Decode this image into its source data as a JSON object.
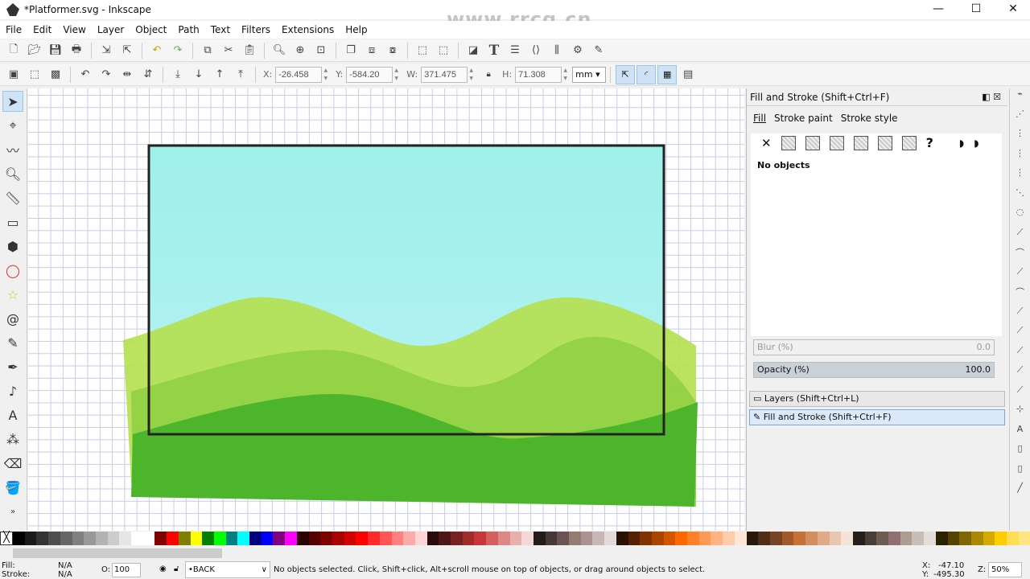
{
  "window": {
    "title": "*Platformer.svg - Inkscape",
    "minimize": "—",
    "maximize": "☐",
    "close": "✕"
  },
  "watermark": "www.rrcg.cn",
  "menu": [
    "File",
    "Edit",
    "View",
    "Layer",
    "Object",
    "Path",
    "Text",
    "Filters",
    "Extensions",
    "Help"
  ],
  "toolbar1_icons": [
    "new-icon",
    "open-icon",
    "save-icon",
    "print-icon",
    "import-icon",
    "export-icon",
    "undo-icon",
    "redo-icon",
    "copy-icon",
    "cut-icon",
    "paste-icon",
    "zoom-selection-icon",
    "zoom-drawing-icon",
    "zoom-page-icon",
    "duplicate-icon",
    "clone-icon",
    "unlink-clone-icon",
    "group-icon",
    "ungroup-icon",
    "fill-stroke-icon",
    "text-font-icon",
    "layers-icon",
    "xml-editor-icon",
    "align-icon",
    "preferences-icon",
    "document-properties-icon"
  ],
  "toolbar2": {
    "x_label": "X:",
    "x": "-26.458",
    "y_label": "Y:",
    "y": "-584.20",
    "w_label": "W:",
    "w": "371.475",
    "h_label": "H:",
    "h": "71.308",
    "unit": "mm"
  },
  "tools": [
    "selector",
    "node",
    "tweak",
    "zoom",
    "measure",
    "rectangle",
    "3d-box",
    "ellipse",
    "star",
    "spiral",
    "pencil",
    "pen",
    "calligraphy",
    "text",
    "spray",
    "eraser",
    "paint-bucket"
  ],
  "panel": {
    "title": "Fill and Stroke (Shift+Ctrl+F)",
    "tabs": [
      "Fill",
      "Stroke paint",
      "Stroke style"
    ],
    "message": "No objects",
    "blur_label": "Blur (%)",
    "blur": "0.0",
    "opacity_label": "Opacity (%)",
    "opacity": "100.0",
    "docked": [
      "Layers (Shift+Ctrl+L)",
      "Fill and Stroke (Shift+Ctrl+F)"
    ]
  },
  "colors": {
    "sky_top": "#9ef0e8",
    "sky_bottom": "#b6f2f4",
    "hill_back": "#b5e04e",
    "hill_mid": "#8ecf42",
    "hill_front": "#4db52c",
    "accent": "#cfe3f7"
  },
  "palette": [
    "#000000",
    "#1a1a1a",
    "#333333",
    "#4d4d4d",
    "#666666",
    "#808080",
    "#999999",
    "#b3b3b3",
    "#cccccc",
    "#e6e6e6",
    "#ffffff",
    "#ffffff",
    "#800000",
    "#ff0000",
    "#808000",
    "#ffff00",
    "#008000",
    "#00ff00",
    "#008080",
    "#00ffff",
    "#000080",
    "#0000ff",
    "#800080",
    "#ff00ff",
    "#2b0000",
    "#550000",
    "#800000",
    "#aa0000",
    "#d40000",
    "#ff0000",
    "#ff2a2a",
    "#ff5555",
    "#ff8080",
    "#ffaaaa",
    "#ffd5d5",
    "#280b0b",
    "#501616",
    "#782121",
    "#a02c2c",
    "#c83737",
    "#d35f5f",
    "#de8787",
    "#e9afaf",
    "#f4d7d7",
    "#241c1c",
    "#483737",
    "#6c5353",
    "#917c6f",
    "#ac9393",
    "#c8b7b7",
    "#e3dbdb",
    "#2b1100",
    "#552200",
    "#803300",
    "#aa4400",
    "#d45500",
    "#ff6600",
    "#ff7f2a",
    "#ff9955",
    "#ffb380",
    "#ffccaa",
    "#ffe6d5",
    "#28170b",
    "#502d16",
    "#784421",
    "#a05a2c",
    "#c87137",
    "#d38d5f",
    "#deaa87",
    "#e9c6af",
    "#f4e3d7",
    "#241f1c",
    "#483e37",
    "#6c5d53",
    "#916f6f",
    "#ac9d93",
    "#c8beb7",
    "#e3dedb",
    "#2b2200",
    "#554400",
    "#806600",
    "#aa8800",
    "#d4aa00",
    "#ffcc00",
    "#ffdd55",
    "#ffe680"
  ],
  "status": {
    "fill_label": "Fill:",
    "fill": "N/A",
    "stroke_label": "Stroke:",
    "stroke": "N/A",
    "opacity_label": "O:",
    "opacity": "100",
    "layer": "•BACK",
    "message": "No objects selected. Click, Shift+click, Alt+scroll mouse on top of objects, or drag around objects to select.",
    "x_label": "X:",
    "x": "-47.10",
    "y_label": "Y:",
    "y": "-495.30",
    "zoom_label": "Z:",
    "zoom": "50%"
  }
}
